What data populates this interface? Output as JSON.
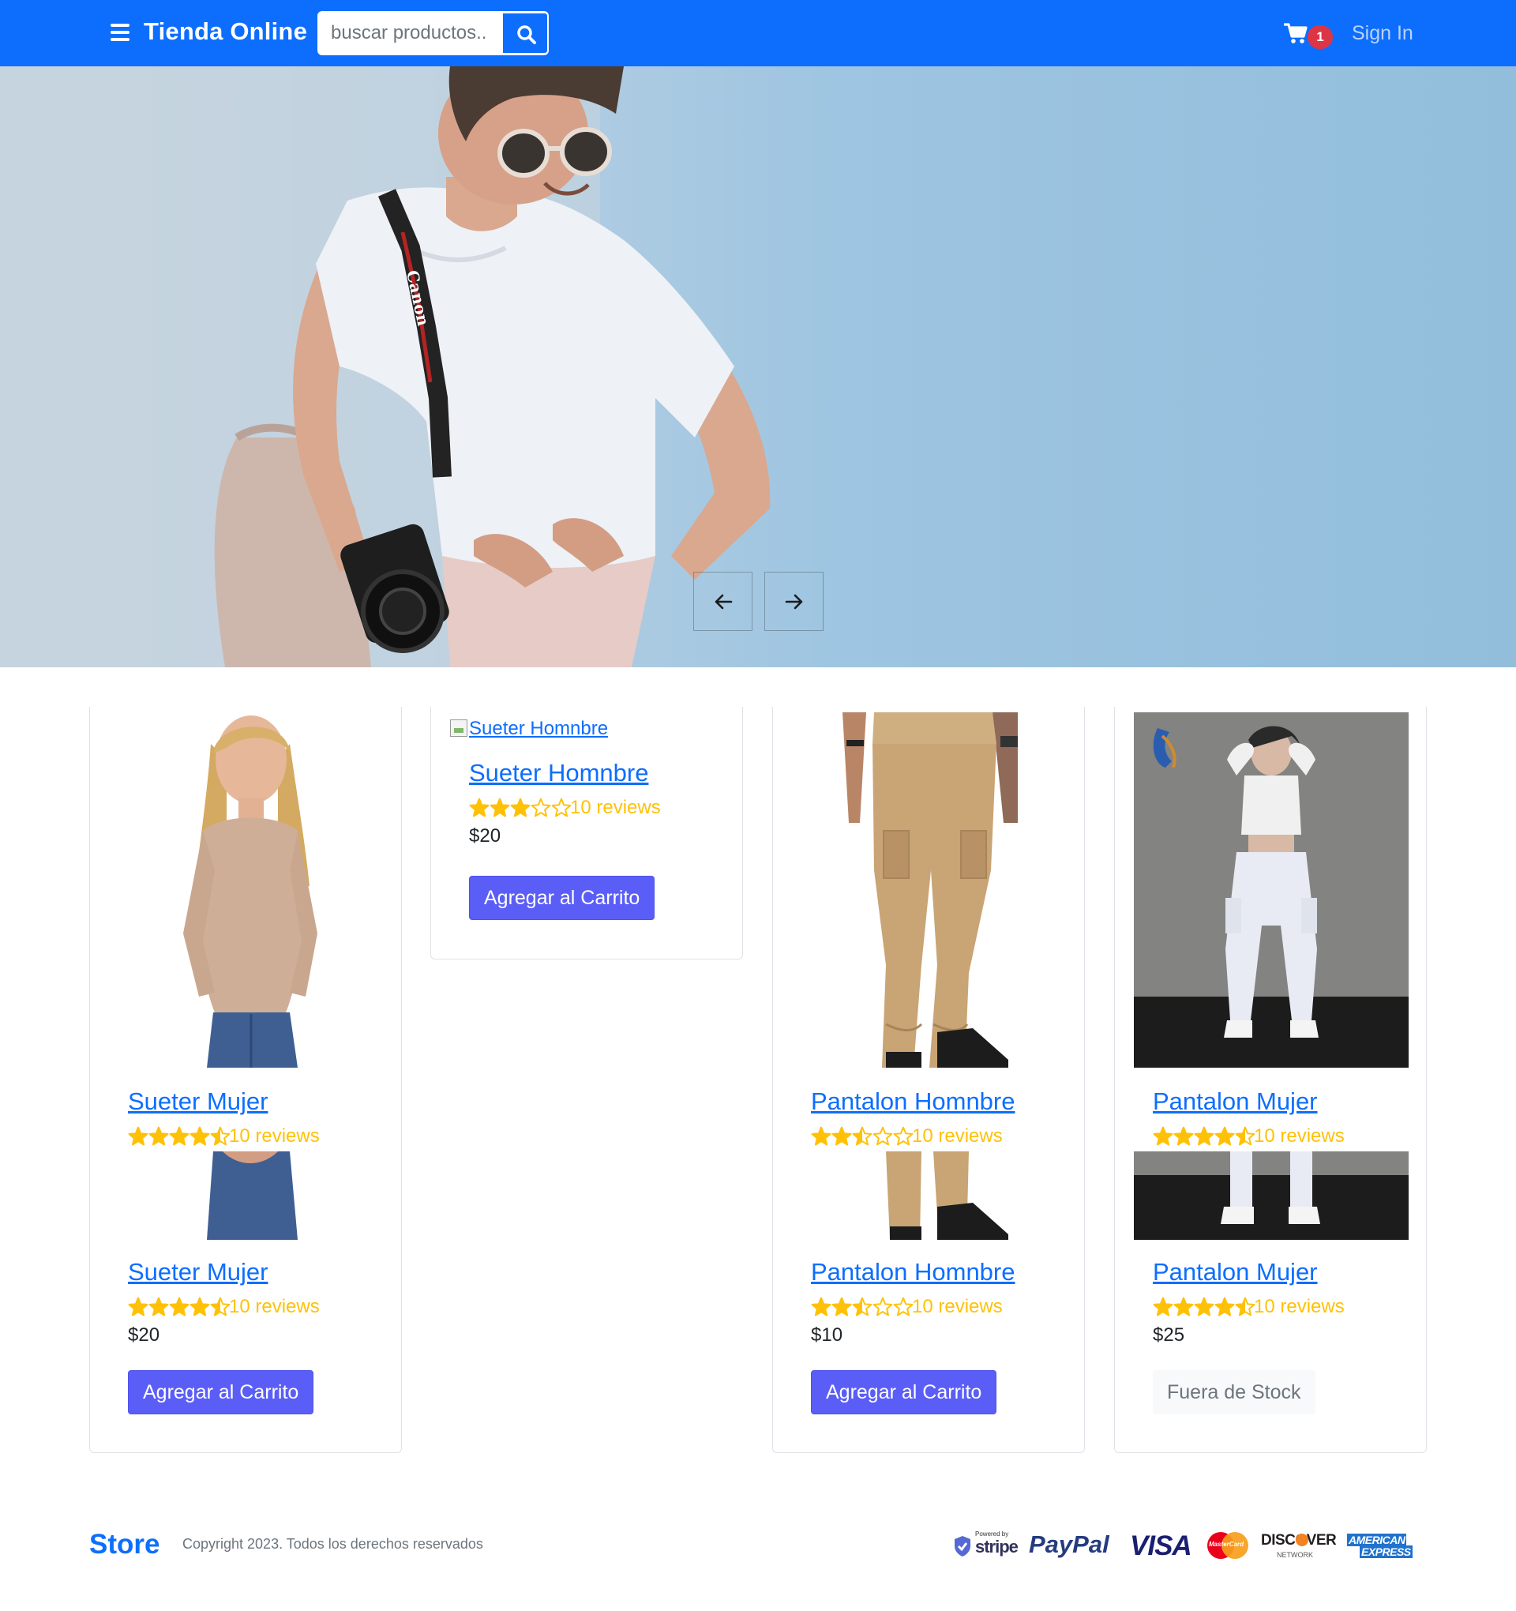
{
  "navbar": {
    "menu_icon": "hamburger-icon",
    "brand": "Tienda Online",
    "search_placeholder": "buscar productos..",
    "search_icon": "search-icon",
    "cart_icon": "cart-icon",
    "cart_count": "1",
    "signin_label": "Sign In",
    "colors": {
      "background": "#0d6efd",
      "badge": "#dc3545"
    }
  },
  "hero": {
    "prev_icon": "arrow-left-icon",
    "next_icon": "arrow-right-icon"
  },
  "products": [
    {
      "name": "Sueter Mujer",
      "rating": 4.5,
      "reviews": "10 reviews",
      "price": "$20",
      "action": "Agregar al Carrito",
      "in_stock": true
    },
    {
      "name": "Sueter Homnbre",
      "image_alt": "Sueter Homnbre",
      "rating": 3,
      "reviews": "10 reviews",
      "price": "$20",
      "action": "Agregar al Carrito",
      "in_stock": true
    },
    {
      "name": "Pantalon Homnbre",
      "rating": 2.5,
      "reviews": "10 reviews",
      "price": "$10",
      "action": "Agregar al Carrito",
      "in_stock": true
    },
    {
      "name": "Pantalon Mujer",
      "rating": 4.5,
      "reviews": "10 reviews",
      "price": "$25",
      "action": "Fuera de Stock",
      "in_stock": false
    }
  ],
  "footer": {
    "brand": "Store",
    "copyright": "Copyright 2023. Todos los derechos reservados",
    "payment_logos": {
      "stripe_small": "Powered by",
      "stripe": "stripe",
      "paypal": "PayPal",
      "visa": "VISA",
      "mastercard": "MasterCard",
      "discover": "DISCOVER",
      "discover_sub": "NETWORK",
      "amex_1": "AMERICAN",
      "amex_2": "EXPRESS"
    }
  },
  "colors": {
    "accent": "#0d6efd",
    "button": "#5b5ef6",
    "star": "#ffc107"
  }
}
